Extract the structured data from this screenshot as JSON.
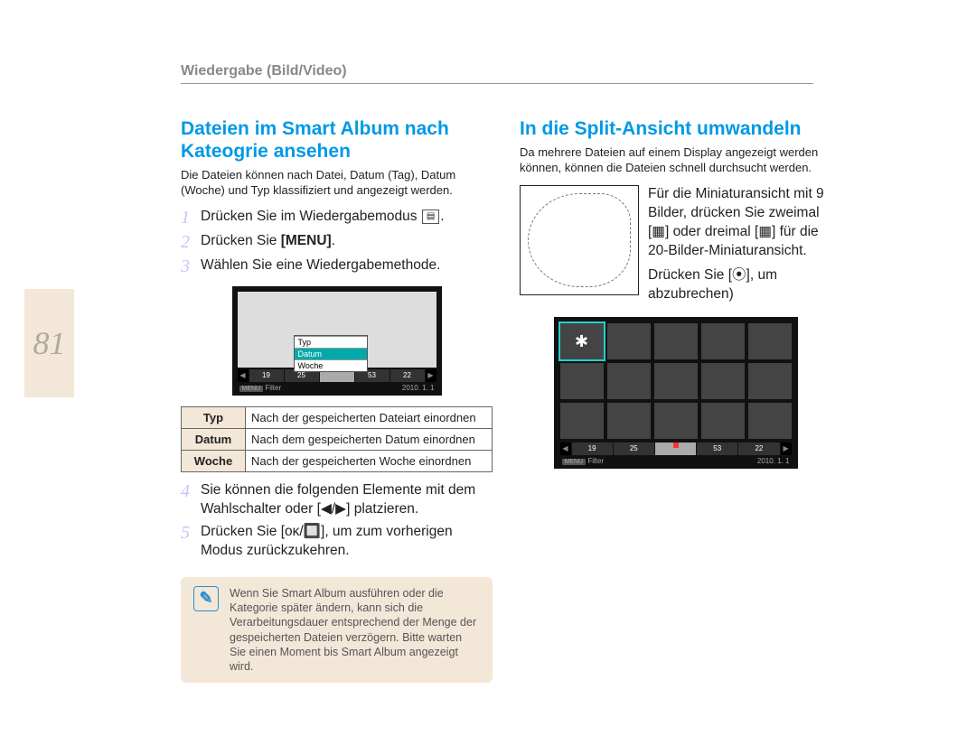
{
  "breadcrumb": "Wiedergabe (Bild/Video)",
  "page_number": "81",
  "left": {
    "heading": "Dateien im Smart Album nach Kateogrie ansehen",
    "intro": "Die Dateien können nach Datei, Datum (Tag), Datum (Woche) und Typ klassifiziert und angezeigt werden.",
    "steps": {
      "s1": "Drücken Sie im Wiedergabemodus ",
      "s1_tail": ".",
      "s2_a": "Drücken Sie ",
      "s2_b": "[MENU]",
      "s2_c": ".",
      "s3": "Wählen Sie eine Wiedergabemethode.",
      "s4": "Sie können die folgenden Elemente mit dem Wahlschalter oder [◀/▶] platzieren.",
      "s5": "Drücken Sie [ᴏᴋ/🔲], um zum vorherigen Modus zurückzukehren."
    },
    "screen": {
      "dropdown": [
        "Typ",
        "Datum",
        "Woche"
      ],
      "timeline": [
        "19",
        "25",
        "",
        "53",
        "22"
      ],
      "menu_label": "MENU",
      "filter_label": "Filter",
      "date": "2010. 1. 1"
    },
    "table": [
      {
        "key": "Typ",
        "val": "Nach der gespeicherten Dateiart einordnen"
      },
      {
        "key": "Datum",
        "val": "Nach dem gespeicherten Datum einordnen"
      },
      {
        "key": "Woche",
        "val": "Nach der gespeicherten Woche einordnen"
      }
    ],
    "note": "Wenn Sie Smart Album ausführen oder die Kategorie später ändern, kann sich die Verarbeitungsdauer entsprechend der Menge der gespeicherten Dateien verzögern. Bitte warten Sie einen Moment bis Smart Album angezeigt wird."
  },
  "right": {
    "heading": "In die Split-Ansicht umwandeln",
    "intro": "Da mehrere Dateien auf einem Display angezeigt werden können, können die Dateien schnell durchsucht werden.",
    "desc1": "Für die Miniaturansicht mit 9 Bilder, drücken Sie zweimal [▦] oder dreimal [▦] für die 20-Bilder-Miniaturansicht.",
    "desc2": "Drücken Sie [⦿], um abzubrechen)",
    "screen": {
      "timeline": [
        "19",
        "25",
        "",
        "53",
        "22"
      ],
      "menu_label": "MENU",
      "filter_label": "Filter",
      "date": "2010. 1. 1"
    }
  }
}
